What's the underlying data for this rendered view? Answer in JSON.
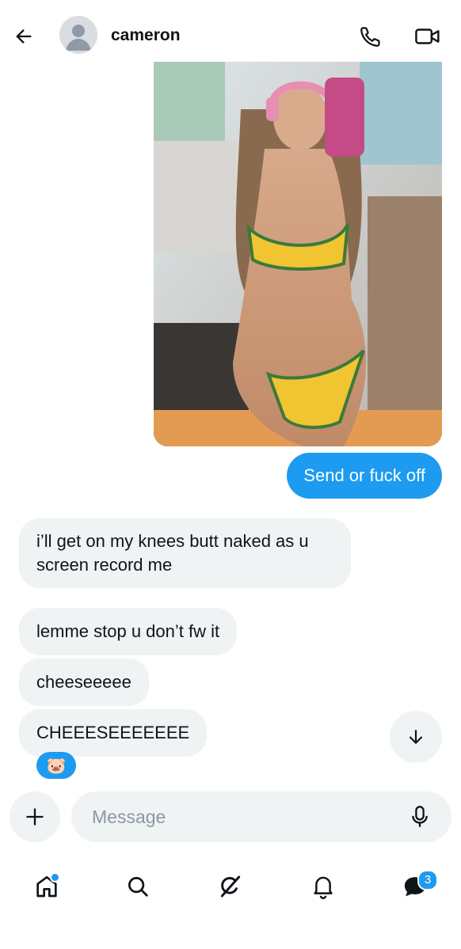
{
  "header": {
    "back_icon": "arrow-left-icon",
    "contact_name": "cameron",
    "call_icon": "phone-icon",
    "video_icon": "video-camera-icon"
  },
  "conversation": {
    "photo_message": {
      "icon": "image-attachment",
      "sender": "me"
    },
    "sent_messages": [
      {
        "text": "Send or fuck off"
      }
    ],
    "received_messages": [
      {
        "text": "i’ll get on my knees butt naked as u screen record me"
      },
      {
        "text": "lemme stop u don’t fw it"
      },
      {
        "text": "cheeseeeee"
      },
      {
        "text": "CHEEESEEEEEEE"
      }
    ],
    "reaction": "🐷",
    "scroll_down_icon": "arrow-down-icon"
  },
  "composer": {
    "add_icon": "plus-icon",
    "placeholder": "Message",
    "value": "",
    "mic_icon": "microphone-icon"
  },
  "bottom_nav": {
    "items": [
      {
        "name": "home",
        "icon": "home-icon",
        "has_dot": true
      },
      {
        "name": "search",
        "icon": "search-icon"
      },
      {
        "name": "grok",
        "icon": "grok-icon"
      },
      {
        "name": "notifications",
        "icon": "bell-icon"
      },
      {
        "name": "messages",
        "icon": "messages-icon",
        "badge": "3"
      }
    ]
  },
  "colors": {
    "accent": "#1d9bf0",
    "bubble_received": "#eff3f4",
    "text": "#0f1419",
    "placeholder": "#8b98a5"
  }
}
